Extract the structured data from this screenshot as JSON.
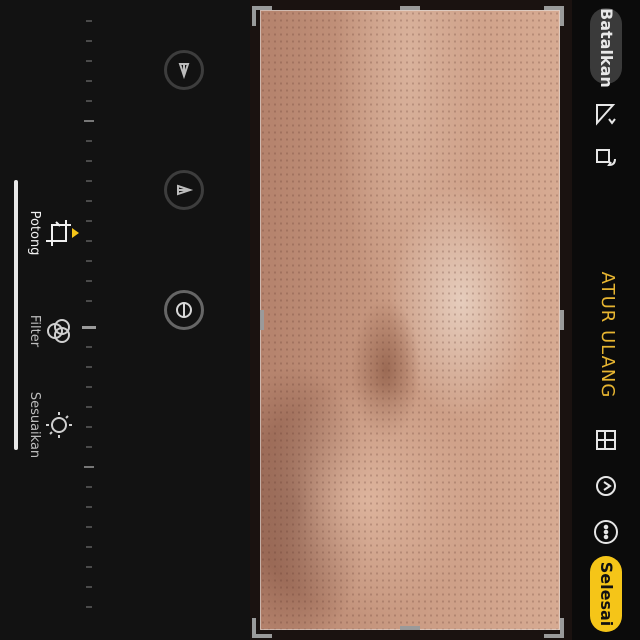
{
  "topbar": {
    "cancel_label": "Batalkan",
    "title": "ATUR ULANG",
    "done_label": "Selesai",
    "icons": [
      "rotate-icon",
      "flip-icon",
      "aspect-ratio-icon",
      "auto-straighten-icon",
      "more-icon"
    ]
  },
  "tools": {
    "adjust_buttons": [
      "straighten-icon",
      "vertical-perspective-icon",
      "horizontal-perspective-icon"
    ],
    "tabs": [
      {
        "label": "Sesuaikan",
        "icon": "adjust-icon",
        "active": false
      },
      {
        "label": "Filter",
        "icon": "filter-icon",
        "active": false
      },
      {
        "label": "Potong",
        "icon": "crop-icon",
        "active": true
      }
    ]
  },
  "colors": {
    "accent": "#f5c518",
    "title": "#e7b531",
    "background": "#121212"
  }
}
